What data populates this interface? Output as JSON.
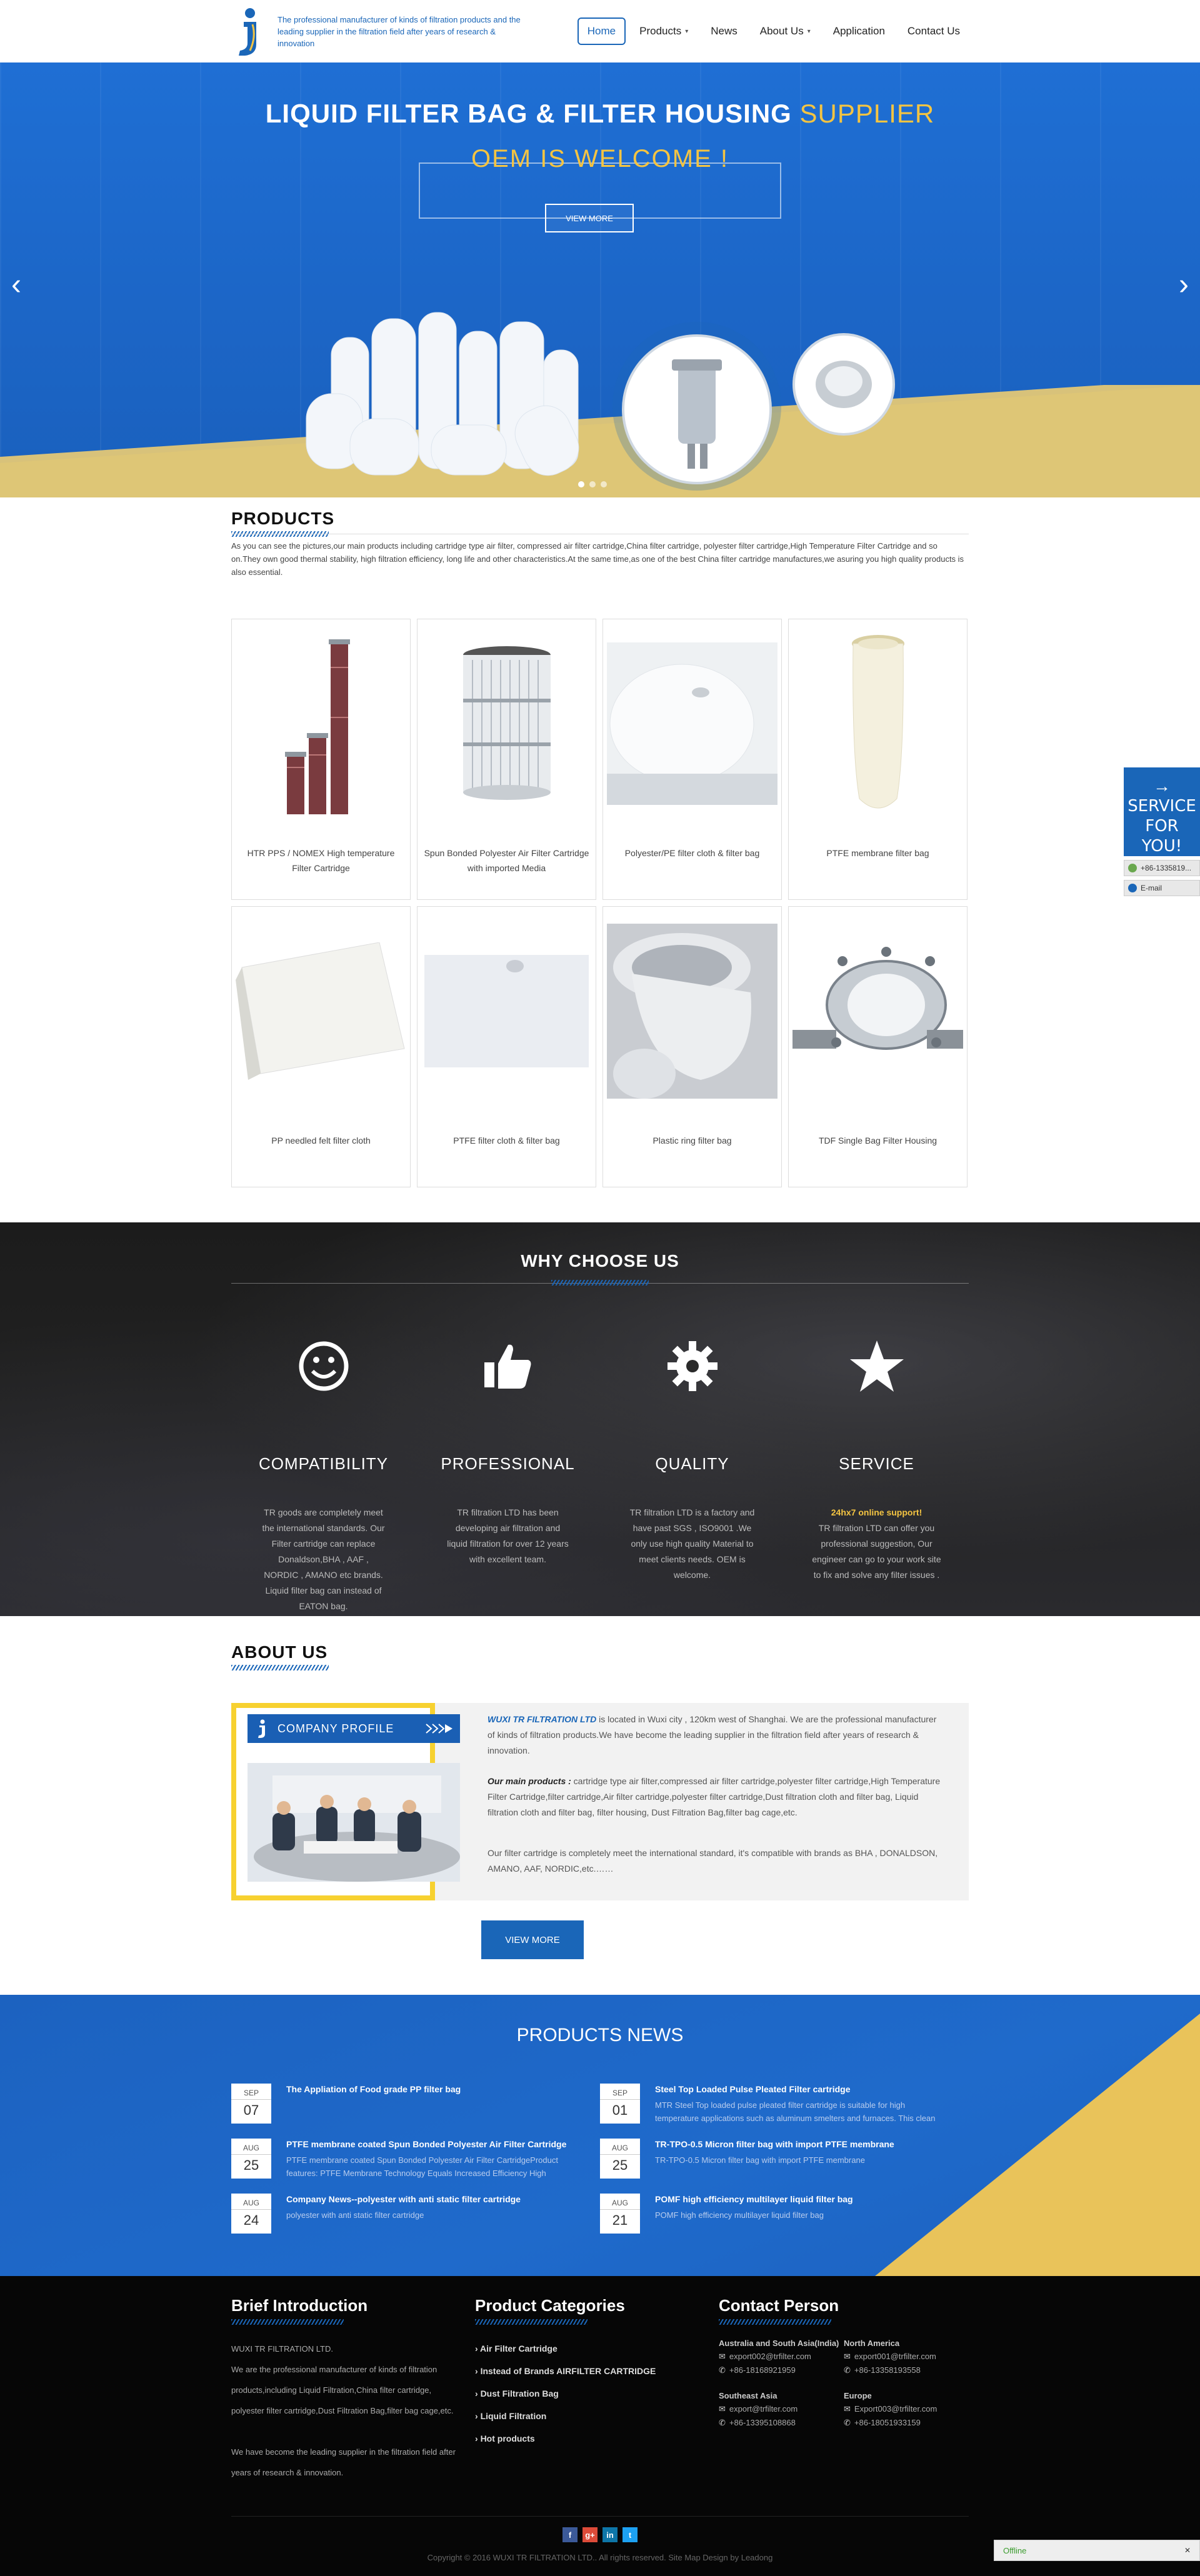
{
  "header": {
    "tagline": "The professional manufacturer of kinds of filtration products and the leading supplier in the filtration field after years of research & innovation",
    "nav": [
      "Home",
      "Products",
      "News",
      "About Us",
      "Application",
      "Contact Us"
    ]
  },
  "hero": {
    "title_main": "LIQUID FILTER BAG & FILTER HOUSING",
    "title_accent": "SUPPLIER",
    "subtitle": "OEM IS WELCOME !",
    "button": "VIEW MORE",
    "prev_arrow": "‹",
    "next_arrow": "›",
    "slides": 3,
    "active_slide": 1
  },
  "products": {
    "title": "PRODUCTS",
    "description": "As you can see the pictures,our main products including cartridge type air filter, compressed air filter cartridge,China filter cartridge, polyester filter cartridge,High Temperature Filter Cartridge and so on.They own good thermal stability, high filtration efficiency, long life and other characteristics.At the same time,as one of the best China filter cartridge manufactures,we asuring you high quality products is also essential.",
    "items": [
      {
        "name": "HTR PPS / NOMEX High temperature Filter Cartridge"
      },
      {
        "name": "Spun Bonded Polyester Air Filter Cartridge with imported Media"
      },
      {
        "name": "Polyester/PE filter cloth & filter bag"
      },
      {
        "name": "PTFE membrane filter bag"
      },
      {
        "name": "PP needled felt filter cloth"
      },
      {
        "name": "PTFE filter cloth & filter bag"
      },
      {
        "name": "Plastic ring filter bag"
      },
      {
        "name": "TDF Single Bag Filter Housing"
      }
    ]
  },
  "why": {
    "title": "WHY CHOOSE US",
    "items": [
      {
        "head": "COMPATIBILITY",
        "highlight": "",
        "text": "TR goods are completely meet the international standards. Our Filter cartridge can replace Donaldson,BHA , AAF , NORDIC , AMANO etc brands. Liquid filter bag can instead of EATON bag."
      },
      {
        "head": "PROFESSIONAL",
        "highlight": "",
        "text": "TR filtration LTD has been developing air filtration and liquid filtration for over 12 years with excellent team."
      },
      {
        "head": "QUALITY",
        "highlight": "",
        "text": "TR filtration LTD is a factory and have past SGS , ISO9001 .We only use high quality Material to meet clients needs. OEM is welcome."
      },
      {
        "head": "SERVICE",
        "highlight": "24hx7 online support!",
        "text": "TR filtration LTD can offer you professional suggestion, Our engineer can go to your work site to fix and solve any filter issues ."
      }
    ]
  },
  "about": {
    "title": "ABOUT US",
    "banner": "COMPANY PROFILE",
    "brand": "WUXI TR FILTRATION LTD",
    "p1_rest": " is located in Wuxi city , 120km west of Shanghai. We are the professional manufacturer of kinds of filtration products.We have become the leading supplier in the filtration field after years of research & innovation.",
    "p2_label": "Our main products :",
    "p2_rest": " cartridge type air filter,compressed air filter cartridge,polyester filter cartridge,High Temperature Filter Cartridge,filter cartridge,Air filter cartridge,polyester filter cartridge,Dust filtration cloth and filter bag, Liquid filtration cloth and filter bag, filter housing, Dust Filtration Bag,filter bag cage,etc.",
    "p3": "Our filter cartridge is completely meet the international standard, it's compatible with brands as BHA , DONALDSON, AMANO, AAF, NORDIC,etc.……",
    "button": "VIEW MORE"
  },
  "news": {
    "title": "PRODUCTS NEWS",
    "items": [
      {
        "month": "SEP",
        "day": "07",
        "head": "The Appliation of Food grade PP filter bag",
        "summary": ""
      },
      {
        "month": "SEP",
        "day": "01",
        "head": "Steel Top Loaded Pulse Pleated Filter cartridge",
        "summary": "MTR Steel Top loaded pulse pleated filter cartridge is suitable for high temperature applications such as aluminum smelters and furnaces. This clean"
      },
      {
        "month": "AUG",
        "day": "25",
        "head": "PTFE membrane coated Spun Bonded Polyester Air Filter Cartridge",
        "summary": "PTFE membrane coated Spun Bonded Polyester Air Filter CartridgeProduct features: PTFE Membrane Technology Equals Increased Efficiency High"
      },
      {
        "month": "AUG",
        "day": "25",
        "head": "TR-TPO-0.5 Micron filter bag with import PTFE membrane",
        "summary": "TR-TPO-0.5 Micron filter bag with import PTFE membrane"
      },
      {
        "month": "AUG",
        "day": "24",
        "head": "Company News--polyester with anti static filter cartridge",
        "summary": "polyester with anti static filter cartridge"
      },
      {
        "month": "AUG",
        "day": "21",
        "head": "POMF high efficiency multilayer liquid filter bag",
        "summary": "POMF high efficiency multilayer liquid filter bag"
      }
    ]
  },
  "footer": {
    "brief_title": "Brief Introduction",
    "brief_lines": [
      "WUXI TR FILTRATION LTD.",
      "We are the professional manufacturer of kinds of filtration products,including Liquid Filtration,China filter cartridge, polyester filter cartridge,Dust Filtration Bag,filter bag cage,etc.",
      "",
      "We have become the leading supplier in the filtration field after years of research & innovation."
    ],
    "cat_title": "Product Categories",
    "categories": [
      "Air Filter Cartridge",
      "Instead of Brands AIRFILTER CARTRIDGE",
      "Dust Filtration Bag",
      "Liquid Filtration",
      "Hot products"
    ],
    "contact_title": "Contact Person",
    "contacts": [
      {
        "region": "Australia and South Asia(India)",
        "email": "export002@trfilter.com",
        "phone": "+86-18168921959"
      },
      {
        "region": "North America",
        "email": "export001@trfilter.com",
        "phone": "+86-13358193558"
      },
      {
        "region": "Southeast Asia",
        "email": "export@trfilter.com",
        "phone": "+86-13395108868"
      },
      {
        "region": "Europe",
        "email": "Export003@trfilter.com",
        "phone": "+86-18051933159"
      }
    ],
    "social": [
      "f",
      "g+",
      "in",
      "t"
    ],
    "copyright": "Copyright © 2016 WUXI TR FILTRATION LTD.. All rights reserved. Site Map   Design by Leadong"
  },
  "side": {
    "arrow": "→",
    "line1": "SERVICE",
    "line2": "FOR YOU!",
    "phone": "+86-1335819...",
    "email": "E-mail"
  },
  "chat": {
    "status": "Offline",
    "close": "✕"
  },
  "colors": {
    "brand_blue": "#1a66b8",
    "accent_yellow": "#f4c442"
  }
}
